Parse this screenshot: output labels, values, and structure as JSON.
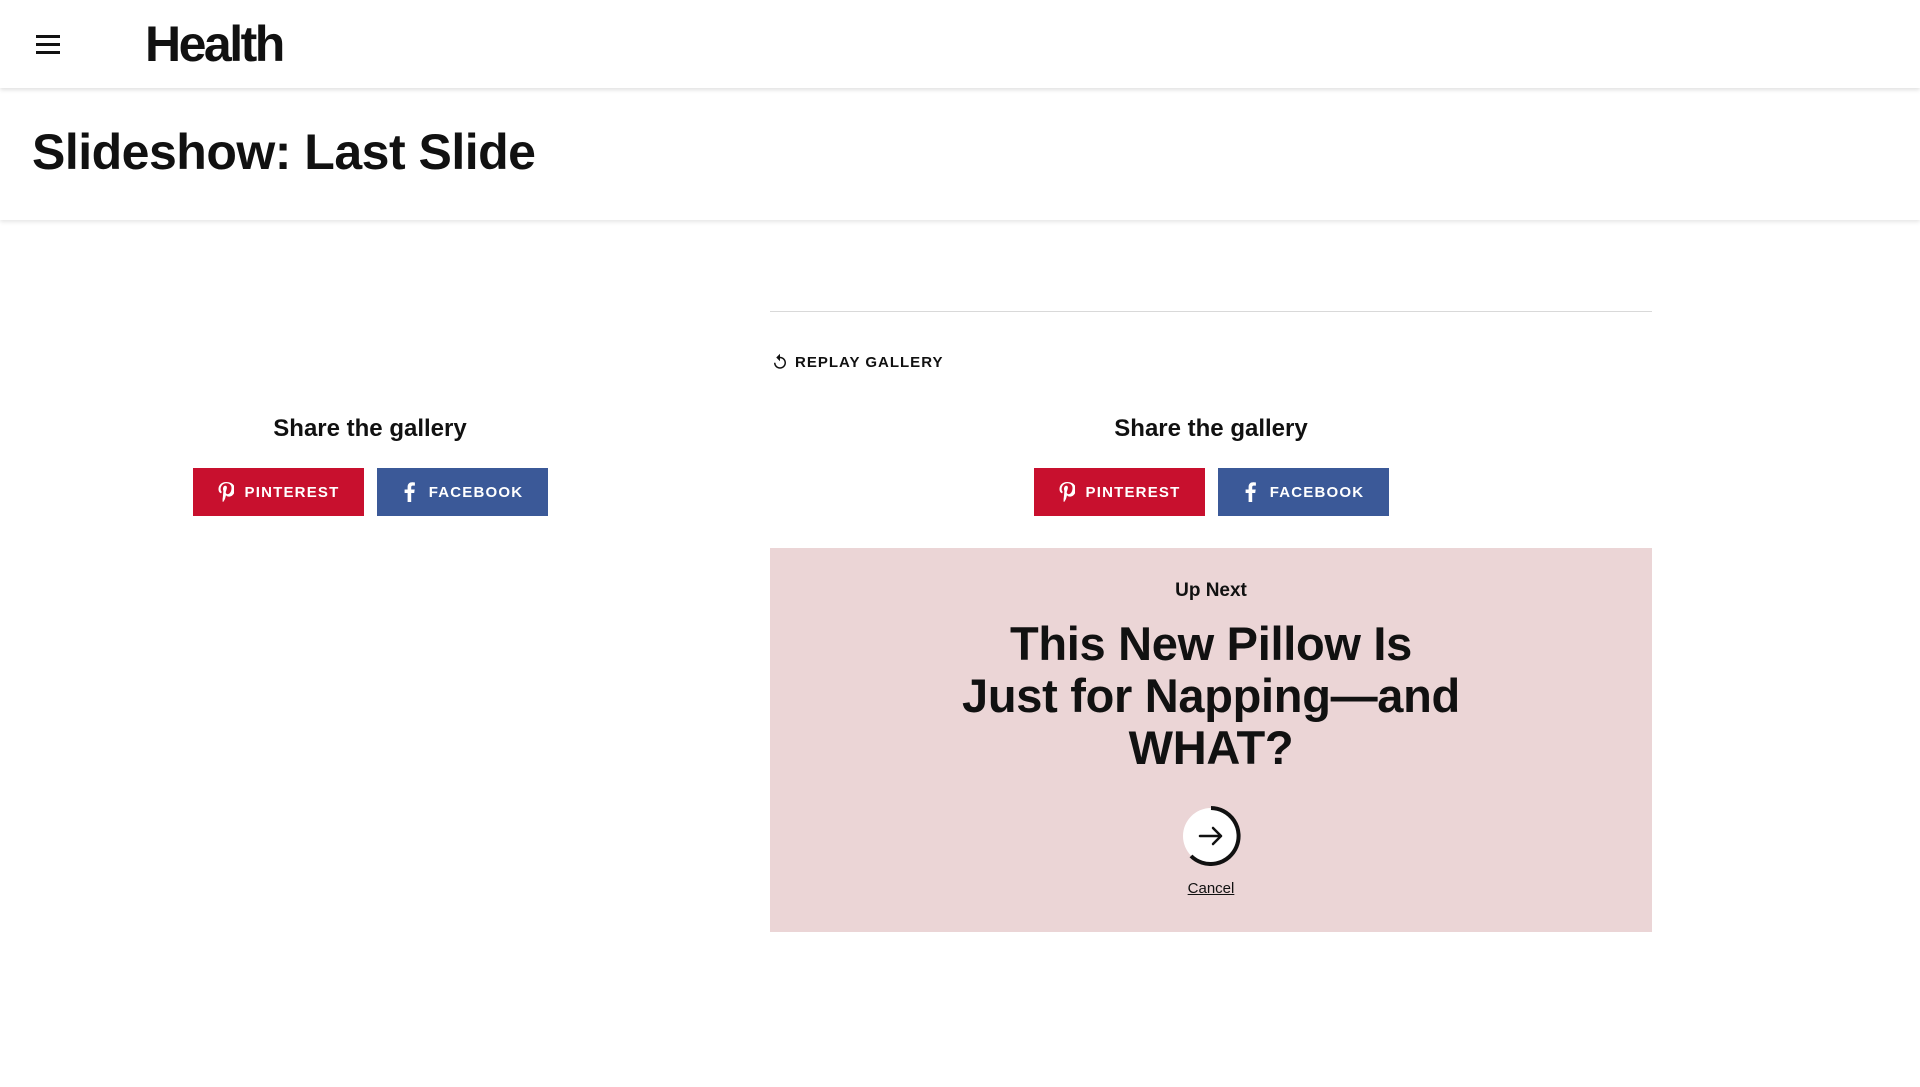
{
  "header": {
    "logo": "Health",
    "menu_icon": "hamburger-menu-icon"
  },
  "page": {
    "title": "Slideshow: Last Slide"
  },
  "replay": {
    "label": "REPLAY GALLERY",
    "icon": "replay-icon"
  },
  "share_left": {
    "title": "Share the gallery",
    "pinterest_label": "PINTEREST",
    "facebook_label": "FACEBOOK"
  },
  "share_right": {
    "title": "Share the gallery",
    "pinterest_label": "PINTEREST",
    "facebook_label": "FACEBOOK"
  },
  "up_next": {
    "label": "Up Next",
    "headline": "This New Pillow Is Just for Napping—and WHAT?",
    "cancel_label": "Cancel",
    "next_icon": "arrow-right-icon",
    "background": "#ebd5d6"
  },
  "colors": {
    "pinterest": "#c8102e",
    "facebook": "#3b5998"
  }
}
